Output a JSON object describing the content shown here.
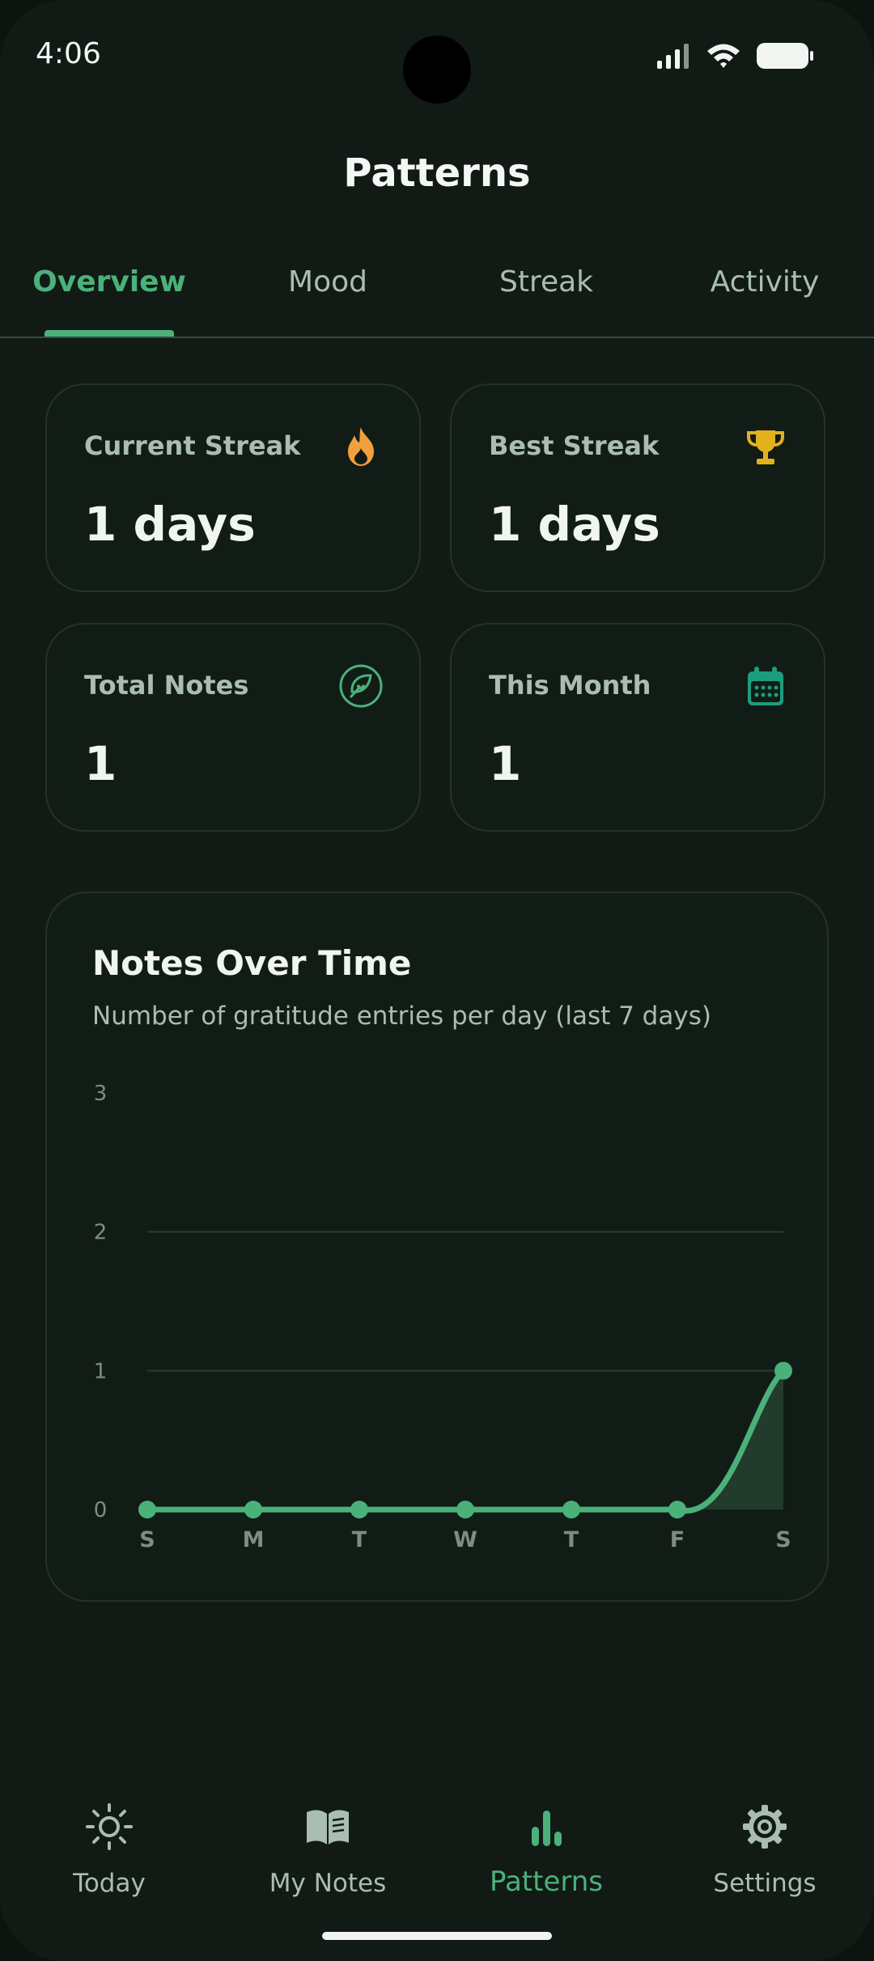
{
  "status_bar": {
    "time": "4:06"
  },
  "header": {
    "title": "Patterns"
  },
  "tabs": [
    {
      "label": "Overview",
      "active": true
    },
    {
      "label": "Mood",
      "active": false
    },
    {
      "label": "Streak",
      "active": false
    },
    {
      "label": "Activity",
      "active": false
    }
  ],
  "stats": {
    "current_streak": {
      "label": "Current Streak",
      "value": "1 days",
      "icon": "flame-icon"
    },
    "best_streak": {
      "label": "Best Streak",
      "value": "1 days",
      "icon": "trophy-icon"
    },
    "total_notes": {
      "label": "Total Notes",
      "value": "1",
      "icon": "leaf-heart-icon"
    },
    "this_month": {
      "label": "This Month",
      "value": "1",
      "icon": "calendar-icon"
    }
  },
  "chart": {
    "title": "Notes Over Time",
    "subtitle": "Number of gratitude entries per day (last 7 days)"
  },
  "chart_data": {
    "type": "area",
    "categories": [
      "S",
      "M",
      "T",
      "W",
      "T",
      "F",
      "S"
    ],
    "values": [
      0,
      0,
      0,
      0,
      0,
      0,
      1
    ],
    "yticks": [
      "0",
      "1",
      "2",
      "3"
    ],
    "ylim": [
      0,
      3
    ],
    "grid": true,
    "colors": {
      "line": "#4bb17a",
      "fill": "#213b2c",
      "grid": "#2c3a31",
      "tick": "#7c8d82"
    }
  },
  "bottom_nav": [
    {
      "label": "Today",
      "icon": "sun-icon",
      "active": false
    },
    {
      "label": "My Notes",
      "icon": "book-icon",
      "active": false
    },
    {
      "label": "Patterns",
      "icon": "bar-chart-icon",
      "active": true
    },
    {
      "label": "Settings",
      "icon": "gear-icon",
      "active": false
    }
  ],
  "colors": {
    "accent": "#4bb17a",
    "background": "#111a15",
    "flame": "#f2a03d",
    "trophy": "#e2b21c",
    "calendar": "#1d9d7f"
  }
}
